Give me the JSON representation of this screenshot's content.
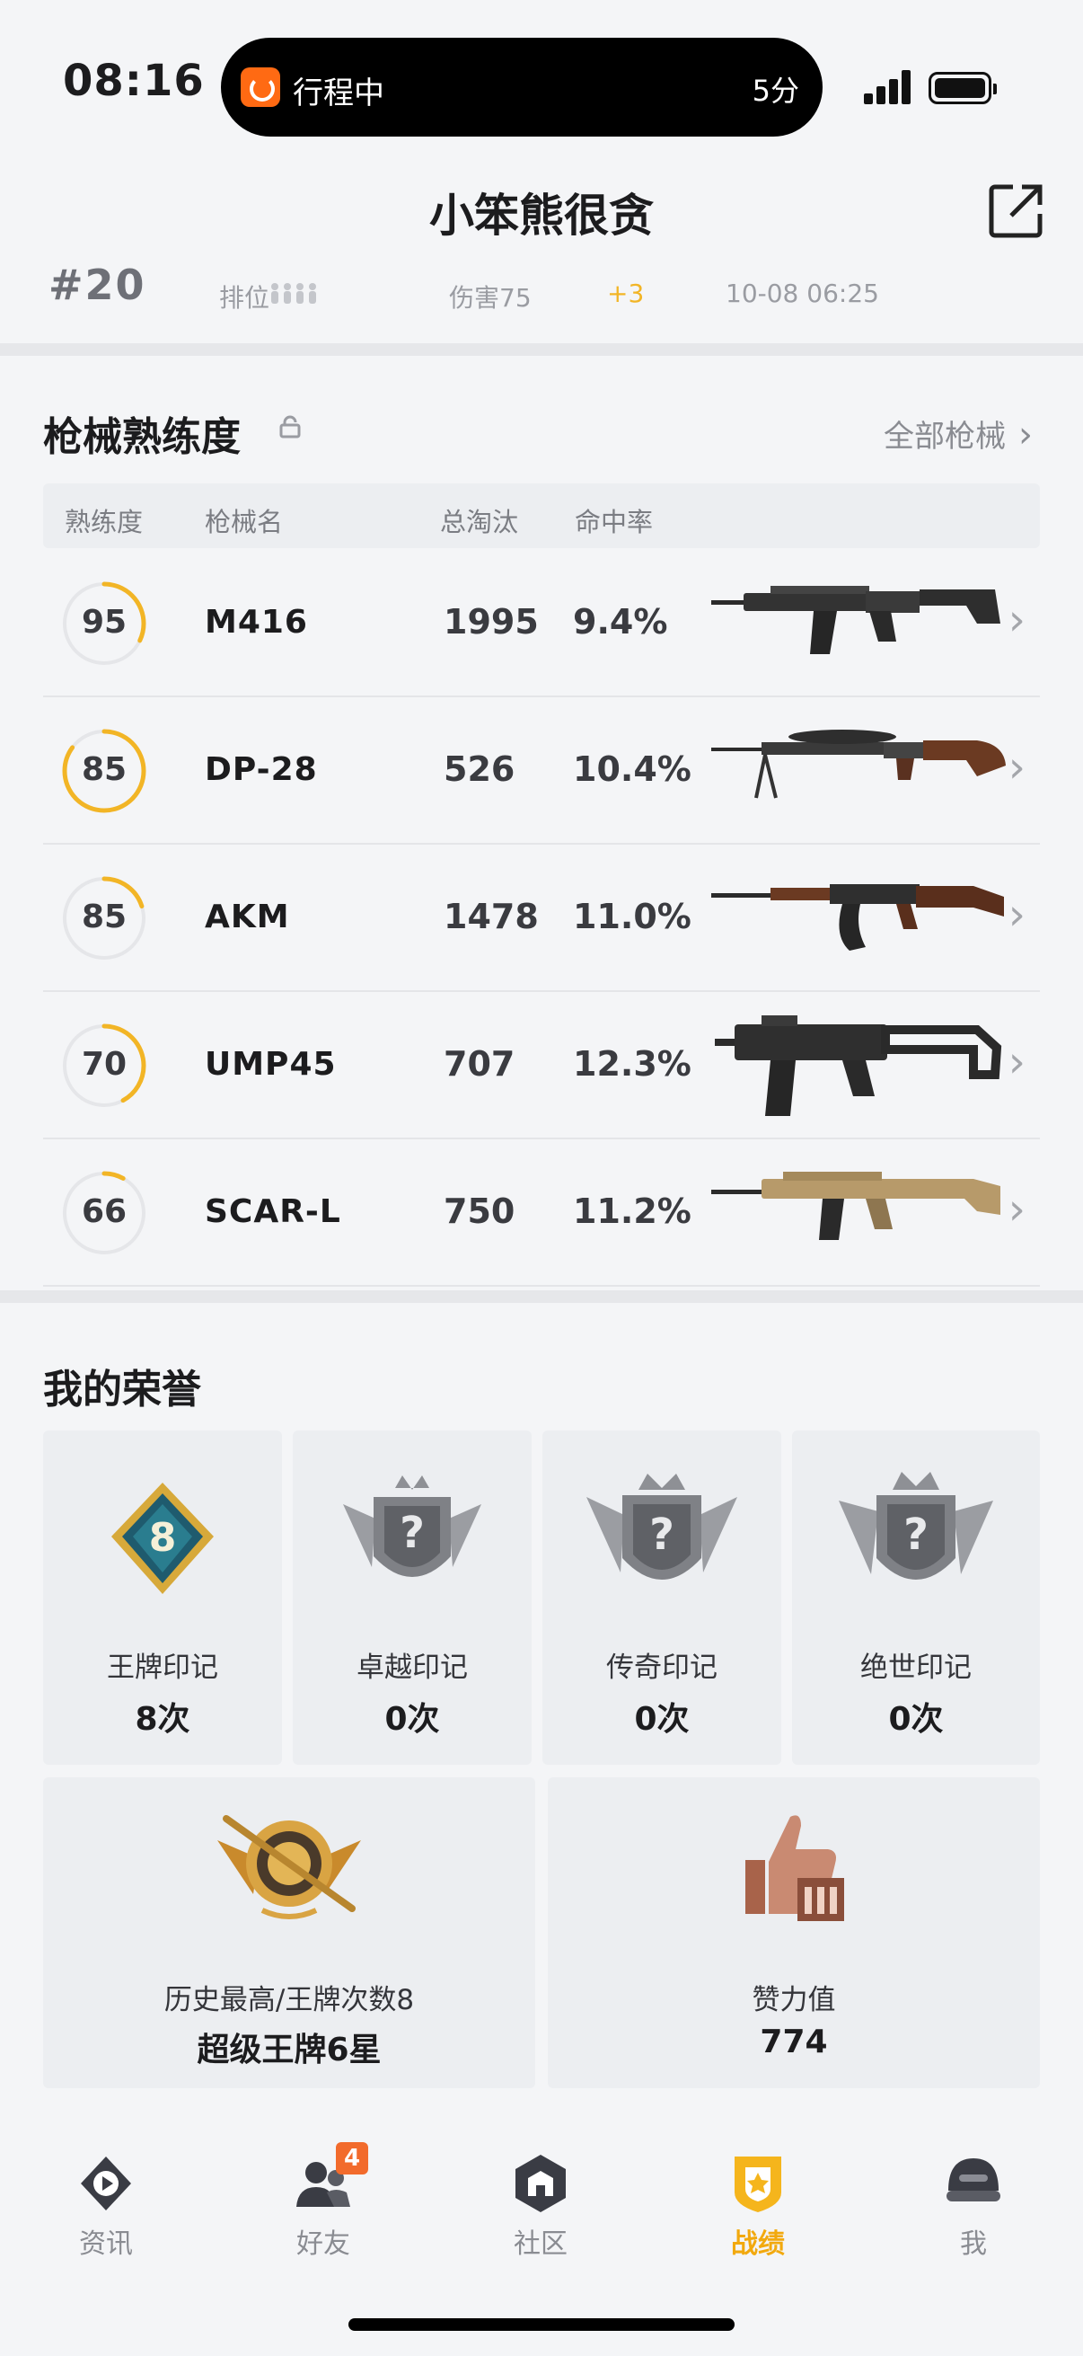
{
  "status_bar": {
    "time": "08:16",
    "trip_label": "行程中",
    "trip_minutes": "5分"
  },
  "nav": {
    "title": "小笨熊很贪"
  },
  "match_row": {
    "rank": "#20",
    "mode": "排位",
    "damage": "伤害75",
    "delta": "+3",
    "datetime": "10-08 06:25"
  },
  "weapons": {
    "title": "枪械熟练度",
    "all_link": "全部枪械",
    "headers": {
      "mastery": "熟练度",
      "name": "枪械名",
      "kills": "总淘汰",
      "accuracy": "命中率"
    },
    "rows": [
      {
        "level": "95",
        "name": "M416",
        "kills": "1995",
        "accuracy": "9.4%",
        "progress": 0.32
      },
      {
        "level": "85",
        "name": "DP-28",
        "kills": "526",
        "accuracy": "10.4%",
        "progress": 0.85
      },
      {
        "level": "85",
        "name": "AKM",
        "kills": "1478",
        "accuracy": "11.0%",
        "progress": 0.2
      },
      {
        "level": "70",
        "name": "UMP45",
        "kills": "707",
        "accuracy": "12.3%",
        "progress": 0.42
      },
      {
        "level": "66",
        "name": "SCAR-L",
        "kills": "750",
        "accuracy": "11.2%",
        "progress": 0.08
      }
    ]
  },
  "honors": {
    "title": "我的荣誉",
    "marks": [
      {
        "name": "王牌印记",
        "count": "8次",
        "badge_number": "8"
      },
      {
        "name": "卓越印记",
        "count": "0次"
      },
      {
        "name": "传奇印记",
        "count": "0次"
      },
      {
        "name": "绝世印记",
        "count": "0次"
      }
    ],
    "peak": {
      "label": "历史最高/王牌次数8",
      "value": "超级王牌6星"
    },
    "likes": {
      "label": "赞力值",
      "value": "774"
    }
  },
  "tabs": [
    {
      "label": "资讯",
      "icon": "news-icon"
    },
    {
      "label": "好友",
      "icon": "friends-icon",
      "badge": "4"
    },
    {
      "label": "社区",
      "icon": "community-icon"
    },
    {
      "label": "战绩",
      "icon": "stats-icon",
      "active": true
    },
    {
      "label": "我",
      "icon": "profile-icon"
    }
  ],
  "colors": {
    "accent": "#f2b526",
    "background": "#f4f5f7",
    "card": "#eceef1"
  }
}
